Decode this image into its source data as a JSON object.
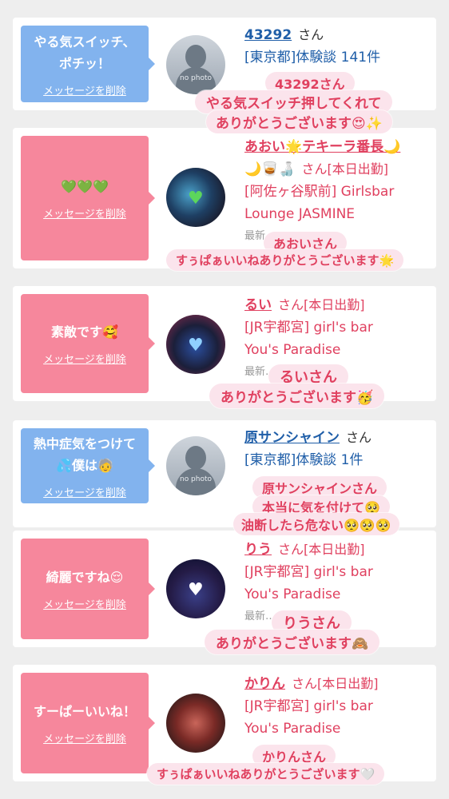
{
  "cards": [
    {
      "bubble_text": "やる気スイッチ、\nポチッ！",
      "delete_label": "メッセージを削除",
      "avatar_text": "no photo",
      "name": "43292",
      "san": "さん",
      "line1": "[東京都]体験談 141件",
      "reply_name": "43292さん",
      "reply_l1": "やる気スイッチ押してくれて",
      "reply_l2": "ありがとうございます😍✨"
    },
    {
      "bubble_text": "💚💚💚",
      "delete_label": "メッセージを削除",
      "name": "あおい🌟テキーラ番長🌙",
      "name2": "🌙🥃🍶",
      "san": "さん[本日出勤]",
      "line1": "[阿佐ヶ谷駅前] Girlsbar",
      "line2": "Lounge JASMINE",
      "stub": "最新…",
      "reply_name": "あおいさん",
      "reply_l1": "すぅぱぁいいねありがとうございます🌟"
    },
    {
      "bubble_text": "素敵です🥰",
      "delete_label": "メッセージを削除",
      "name": "るい",
      "san": "さん[本日出勤]",
      "line1": "[JR宇都宮] girl's bar",
      "line2": "You's Paradise",
      "stub": "最新…",
      "reply_name": "るいさん",
      "reply_l1": "ありがとうございます🥳"
    },
    {
      "bubble_text": "熱中症気をつけて\n💦僕は🧓",
      "delete_label": "メッセージを削除",
      "avatar_text": "no photo",
      "name": "原サンシャイン",
      "san": "さん",
      "line1": "[東京都]体験談 1件",
      "reply_name": "原サンシャインさん",
      "reply_l1": "本当に気を付けて🥺",
      "reply_l2": "油断したら危ない🥺🥺🥺"
    },
    {
      "bubble_text": "綺麗ですね😌",
      "delete_label": "メッセージを削除",
      "name": "りう",
      "san": "さん[本日出勤]",
      "line1": "[JR宇都宮] girl's bar",
      "line2": "You's Paradise",
      "stub": "最新…",
      "reply_name": "りうさん",
      "reply_l1": "ありがとうございます🙈"
    },
    {
      "bubble_text": "すーぱーいいね！",
      "delete_label": "メッセージを削除",
      "name": "かりん",
      "san": "さん[本日出勤]",
      "line1": "[JR宇都宮] girl's bar",
      "line2": "You's Paradise",
      "reply_name": "かりんさん",
      "reply_l1": "すぅぱぁいいねありがとうございます🤍"
    }
  ],
  "colors": {
    "blue": "#82b3ee",
    "pink": "#f6879c",
    "link_blue": "#1f5ea8",
    "link_pink": "#e0405f",
    "reply_bg": "#fbe4ec"
  }
}
